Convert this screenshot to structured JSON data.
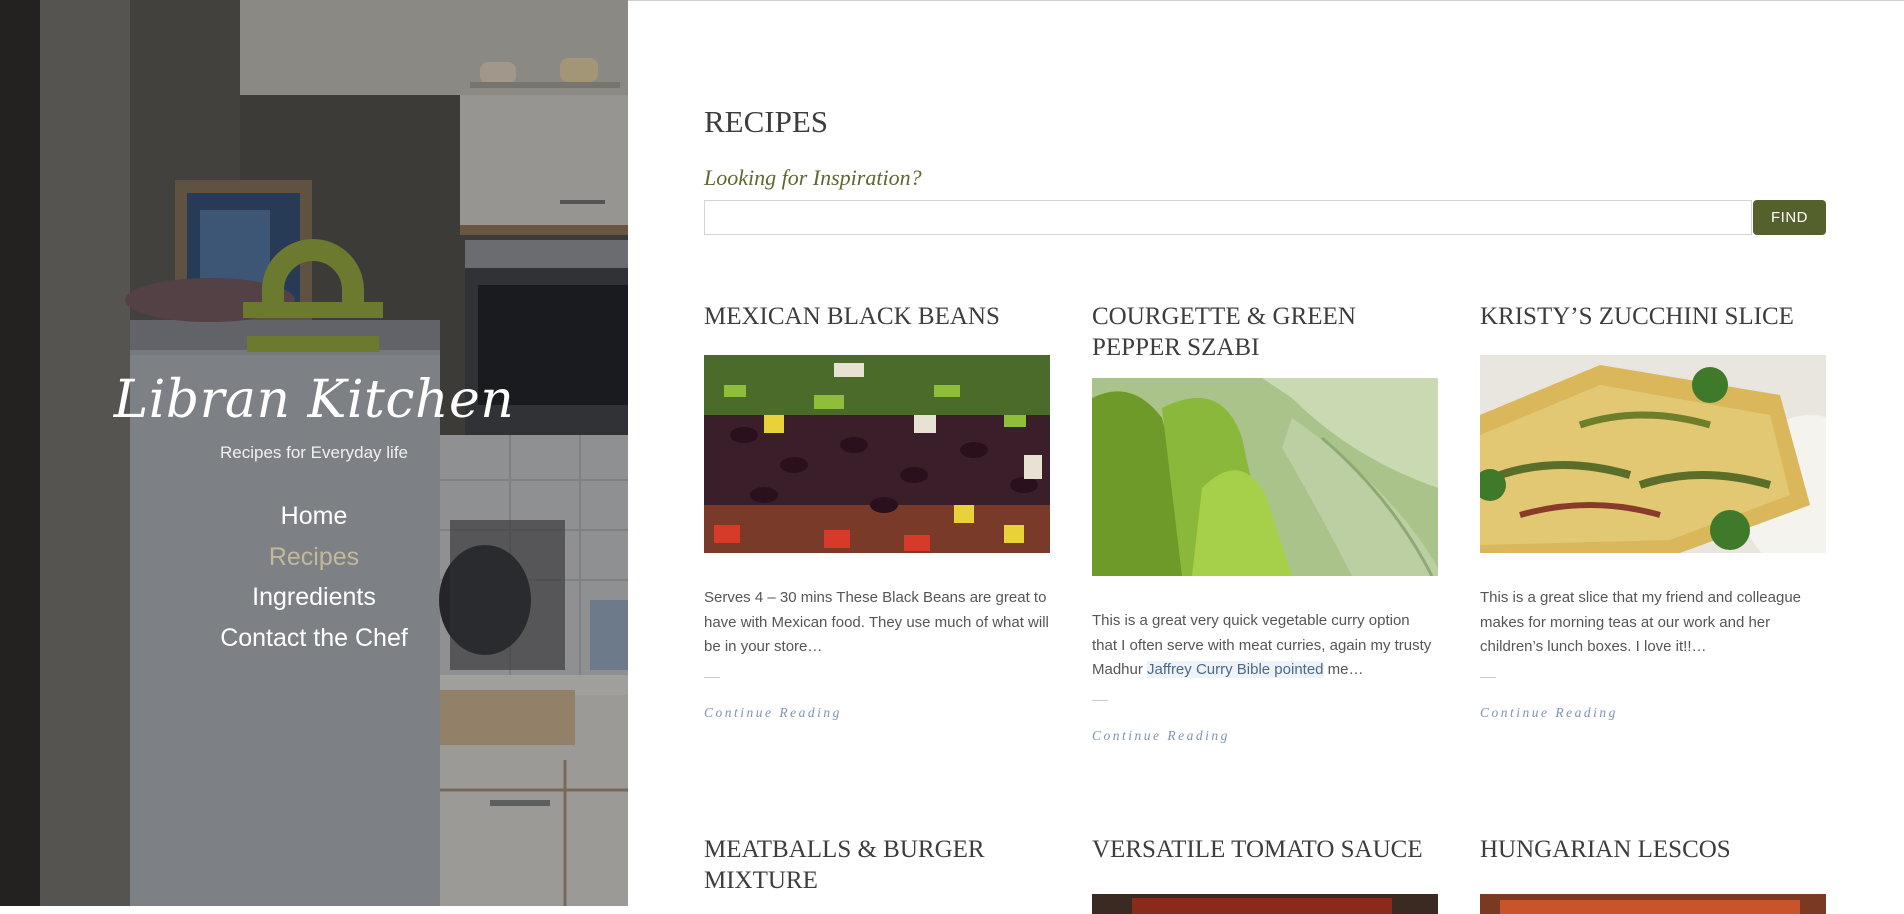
{
  "sidebar": {
    "site_title": "Libran Kitchen",
    "tagline": "Recipes for Everyday life",
    "logo_icon": "libra-symbol-icon",
    "nav": [
      {
        "label": "Home",
        "active": false
      },
      {
        "label": "Recipes",
        "active": true
      },
      {
        "label": "Ingredients",
        "active": false
      },
      {
        "label": "Contact the Chef",
        "active": false
      }
    ]
  },
  "main": {
    "page_title": "RECIPES",
    "search": {
      "label": "Looking for Inspiration?",
      "value": "",
      "button_label": "FIND"
    },
    "recipes": [
      {
        "title": "MEXICAN BLACK BEANS",
        "image": "black-bean-salad-photo",
        "excerpt": "Serves 4 – 30 mins These Black Beans are great to have with Mexican food. They use much of what will be in your store…",
        "read_more": "Continue Reading"
      },
      {
        "title": "COURGETTE & GREEN PEPPER SZABI",
        "image": "green-peppers-courgette-photo",
        "excerpt_before": "This is a great very quick vegetable curry option that I often serve with meat curries, again my trusty Madhur ",
        "excerpt_highlight": "Jaffrey Curry Bible pointed",
        "excerpt_after": " me…",
        "read_more": "Continue Reading"
      },
      {
        "title": "KRISTY’S ZUCCHINI SLICE",
        "image": "zucchini-slice-photo",
        "excerpt": "This is a great slice that my friend and colleague makes for morning teas at our work and her children’s lunch boxes. I love it!!…",
        "read_more": "Continue Reading"
      },
      {
        "title": "MEATBALLS & BURGER MIXTURE",
        "image": "meatballs-photo"
      },
      {
        "title": "VERSATILE TOMATO SAUCE",
        "image": "tomato-sauce-photo"
      },
      {
        "title": "HUNGARIAN LESCOS",
        "image": "lescos-photo"
      }
    ]
  },
  "colors": {
    "accent_olive": "#55612c",
    "logo_olive": "#6b7a2f",
    "active_nav": "#c3b99a",
    "link_blue": "#7d93b2"
  }
}
